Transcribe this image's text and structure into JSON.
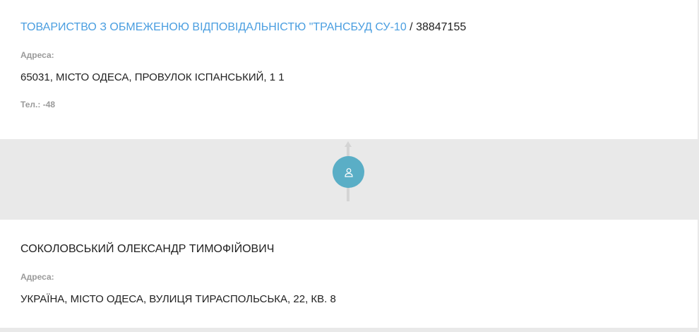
{
  "company": {
    "name": "ТОВАРИСТВО З ОБМЕЖЕНОЮ ВІДПОВІДАЛЬНІСТЮ \"ТРАНСБУД СУ-10",
    "separator": " / ",
    "code": "38847155",
    "address_label": "Адреса:",
    "address": "65031, МІСТО ОДЕСА, ПРОВУЛОК ІСПАНСЬКИЙ, 1 1",
    "phone": "Тел.: -48"
  },
  "connector": {
    "icon": "person-icon",
    "badge_color": "#5aaec6"
  },
  "person": {
    "name": "СОКОЛОВСЬКИЙ ОЛЕКСАНДР ТИМОФІЙОВИЧ",
    "address_label": "Адреса:",
    "address": "УКРАЇНА, МІСТО ОДЕСА, ВУЛИЦЯ ТИРАСПОЛЬСЬКА, 22, КВ. 8"
  },
  "colors": {
    "link": "#4a9ee0",
    "label": "#9a9a9a",
    "text": "#222222",
    "background": "#e9e9e9"
  }
}
